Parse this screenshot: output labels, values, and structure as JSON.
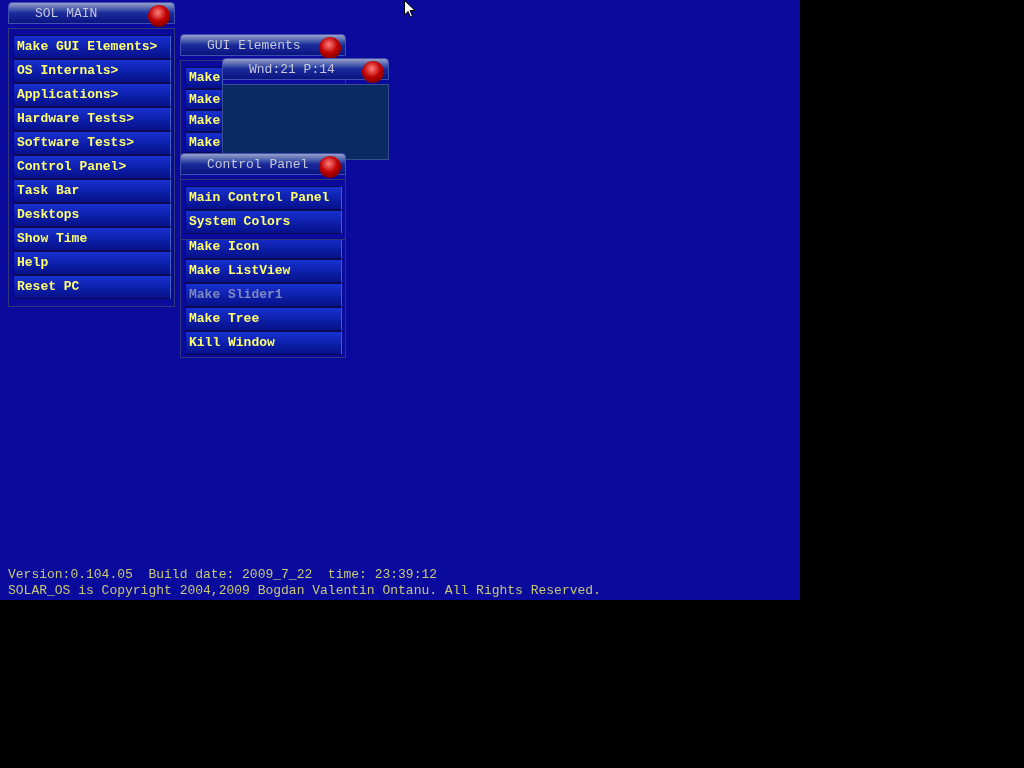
{
  "windows": [
    {
      "kind": "menu",
      "title": "SOL MAIN",
      "groups": [
        {
          "items": [
            {
              "label": "Make GUI Elements>",
              "disabled": false
            },
            {
              "label": "OS Internals>",
              "disabled": false
            },
            {
              "label": "Applications>",
              "disabled": false
            },
            {
              "label": "Hardware Tests>",
              "disabled": false
            },
            {
              "label": "Software Tests>",
              "disabled": false
            },
            {
              "label": "Control Panel>",
              "disabled": false
            },
            {
              "label": "Task Bar",
              "disabled": false
            },
            {
              "label": "Desktops",
              "disabled": false
            },
            {
              "label": "Show Time",
              "disabled": false
            },
            {
              "label": "Help",
              "disabled": false
            },
            {
              "label": "Reset PC",
              "disabled": false
            }
          ]
        }
      ]
    },
    {
      "kind": "menu",
      "title": "GUI Elements",
      "groups": [
        {
          "items": [
            {
              "label": "Make",
              "disabled": false
            },
            {
              "label": "Make",
              "disabled": false
            },
            {
              "label": "Make",
              "disabled": false
            },
            {
              "label": "Make",
              "disabled": false
            }
          ]
        },
        {
          "items": [
            {
              "label": "Make Icon",
              "disabled": false
            },
            {
              "label": "Make ListView",
              "disabled": false
            },
            {
              "label": "Make Slider1",
              "disabled": true
            },
            {
              "label": "Make Tree",
              "disabled": false
            },
            {
              "label": "Kill Window",
              "disabled": false
            }
          ]
        }
      ]
    },
    {
      "kind": "panel",
      "title": "Wnd:21 P:14"
    },
    {
      "kind": "menu",
      "title": "Control Panel",
      "groups": [
        {
          "items": [
            {
              "label": "Main Control Panel",
              "disabled": false
            },
            {
              "label": "System Colors",
              "disabled": false
            }
          ]
        }
      ]
    }
  ],
  "status_lines": [
    "Version:0.104.05  Build date: 2009_7_22  time: 23:39:12",
    "SOLAR_OS is Copyright 2004,2009 Bogdan Valentin Ontanu. All Rights Reserved."
  ]
}
